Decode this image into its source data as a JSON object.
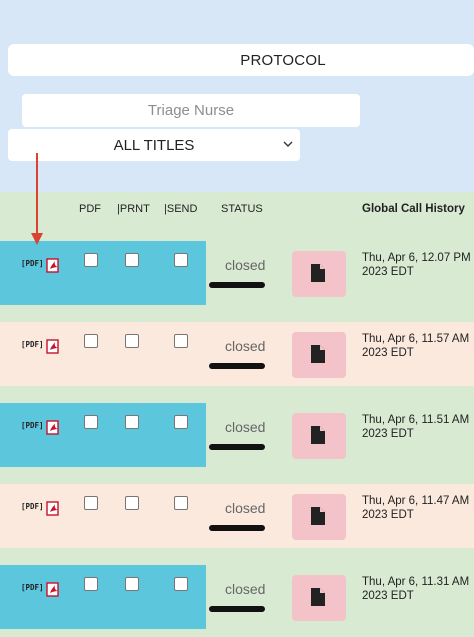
{
  "protocol": {
    "label": "PROTOCOL"
  },
  "filter": {
    "placeholder": "Triage Nurse"
  },
  "titles_select": {
    "value": "ALL TITLES"
  },
  "table": {
    "headers": {
      "pdf": "PDF",
      "print": "|PRNT",
      "send": "|SEND",
      "status": "STATUS",
      "history": "Global Call History"
    },
    "rows": [
      {
        "pdf_tag": "[PDF]",
        "status": "closed",
        "call_time": "Thu, Apr 6, 12.07 PM 2023 EDT"
      },
      {
        "pdf_tag": "[PDF]",
        "status": "closed",
        "call_time": "Thu, Apr 6, 11.57 AM 2023 EDT"
      },
      {
        "pdf_tag": "[PDF]",
        "status": "closed",
        "call_time": "Thu, Apr 6, 11.51 AM 2023 EDT"
      },
      {
        "pdf_tag": "[PDF]",
        "status": "closed",
        "call_time": "Thu, Apr 6, 11.47 AM 2023 EDT"
      },
      {
        "pdf_tag": "[PDF]",
        "status": "closed",
        "call_time": "Thu, Apr 6, 11.31 AM 2023 EDT"
      }
    ]
  },
  "colors": {
    "page_bg": "#d7e7f7",
    "row_blue": "#5bc6dc",
    "row_peach": "#fbe9dd",
    "row_green": "#d9ead3",
    "doc_button": "#f4c2c9",
    "annotation_arrow": "#d9432f"
  },
  "icons": [
    "pdf-icon",
    "document-icon",
    "chevron-down-icon",
    "arrow-annotation"
  ]
}
